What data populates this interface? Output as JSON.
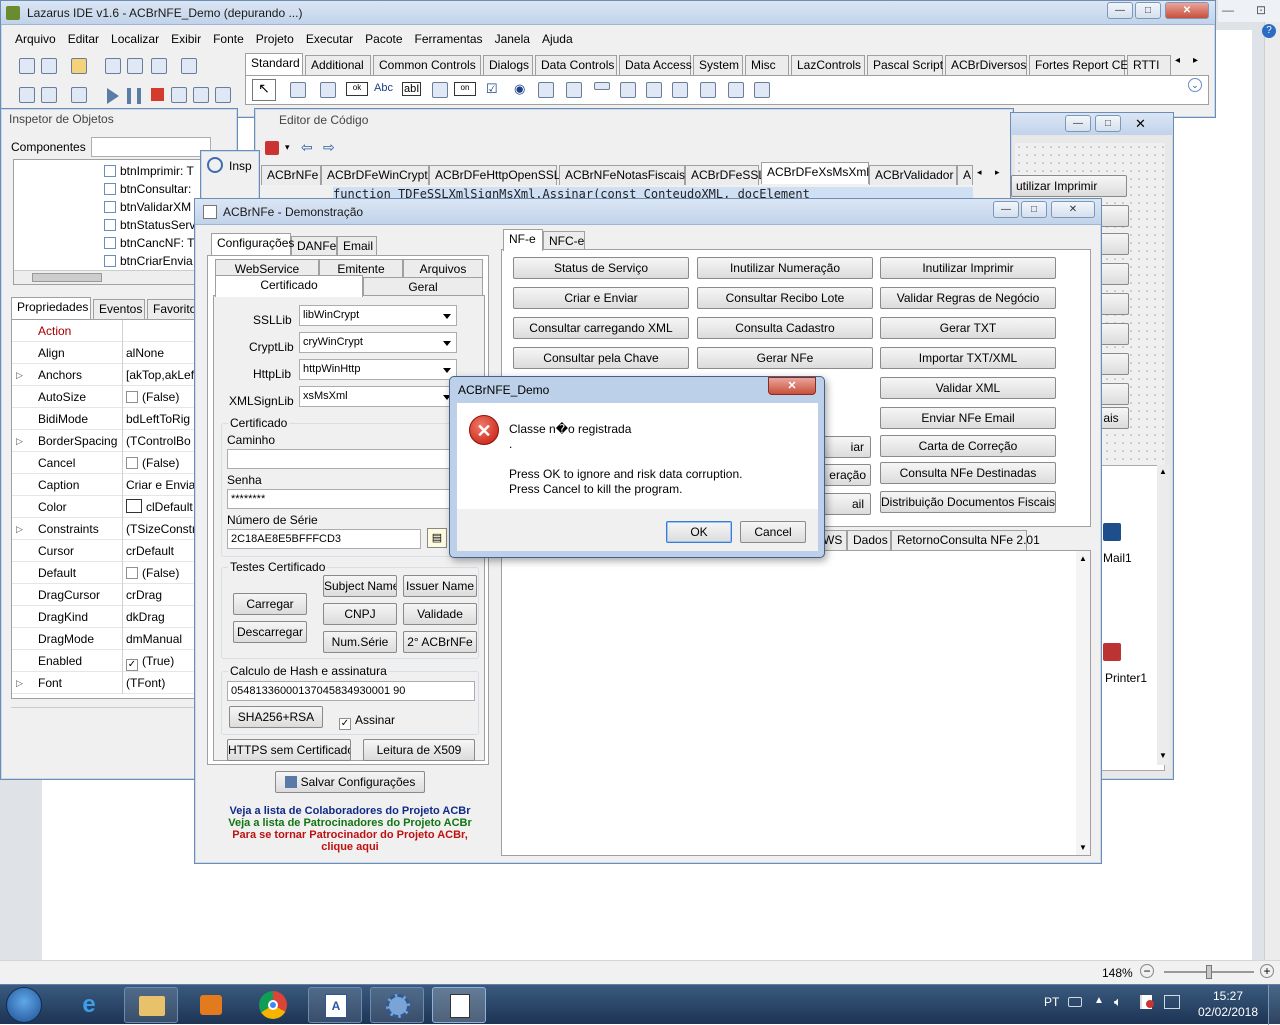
{
  "ide": {
    "title": "Lazarus IDE v1.6 - ACBrNFE_Demo (depurando ...)",
    "menu": [
      "Arquivo",
      "Editar",
      "Localizar",
      "Exibir",
      "Fonte",
      "Projeto",
      "Executar",
      "Pacote",
      "Ferramentas",
      "Janela",
      "Ajuda"
    ],
    "palette_tabs": [
      "Standard",
      "Additional",
      "Common Controls",
      "Dialogs",
      "Data Controls",
      "Data Access",
      "System",
      "Misc",
      "LazControls",
      "Pascal Script",
      "ACBrDiversos",
      "Fortes Report CE",
      "RTTI"
    ]
  },
  "inspector": {
    "title": "Inspetor de Objetos",
    "components_label": "Componentes",
    "tree": [
      "btnImprimir: T",
      "btnConsultar:",
      "btnValidarXM",
      "btnStatusServ",
      "btnCancNF: T",
      "btnCriarEnvia"
    ],
    "tabs": [
      "Propriedades",
      "Eventos",
      "Favorito"
    ],
    "props": [
      {
        "name": "Action",
        "value": ""
      },
      {
        "name": "Align",
        "value": "alNone"
      },
      {
        "name": "Anchors",
        "value": "[akTop,akLeft"
      },
      {
        "name": "AutoSize",
        "value": "(False)"
      },
      {
        "name": "BidiMode",
        "value": "bdLeftToRig"
      },
      {
        "name": "BorderSpacing",
        "value": "(TControlBo"
      },
      {
        "name": "Cancel",
        "value": "(False)"
      },
      {
        "name": "Caption",
        "value": "Criar e Envia"
      },
      {
        "name": "Color",
        "value": "clDefault"
      },
      {
        "name": "Constraints",
        "value": "(TSizeConstr"
      },
      {
        "name": "Cursor",
        "value": "crDefault"
      },
      {
        "name": "Default",
        "value": "(False)"
      },
      {
        "name": "DragCursor",
        "value": "crDrag"
      },
      {
        "name": "DragKind",
        "value": "dkDrag"
      },
      {
        "name": "DragMode",
        "value": "dmManual"
      },
      {
        "name": "Enabled",
        "value": "(True)"
      },
      {
        "name": "Font",
        "value": "(TFont)"
      }
    ]
  },
  "editor": {
    "title": "Editor de Código",
    "tabs": [
      "ACBrNFe",
      "ACBrDFeWinCrypt",
      "ACBrDFeHttpOpenSSL",
      "ACBrNFeNotasFiscais",
      "ACBrDFeSSL",
      "ACBrDFeXsMsXml",
      "ACBrValidador",
      "A"
    ],
    "code_line": "function TDFeSSLXmlSignMsXml.Assinar(const ConteudoXML, docElement"
  },
  "inspector2_title": "Insp",
  "form_designer": {
    "btn_inutilizar_imprimir": "utilizar Imprimir",
    "mail1": "Mail1",
    "printer1": "Printer1"
  },
  "demo": {
    "title": "ACBrNFe - Demonstração",
    "left_tabs": [
      "Configurações",
      "DANFe",
      "Email"
    ],
    "sub_tabs_row1": [
      "WebService",
      "Emitente",
      "Arquivos"
    ],
    "sub_tabs_row2": [
      "Certificado",
      "Geral"
    ],
    "ssllib_label": "SSLLib",
    "ssllib": "libWinCrypt",
    "cryptlib_label": "CryptLib",
    "cryptlib": "cryWinCrypt",
    "httplib_label": "HttpLib",
    "httplib": "httpWinHttp",
    "xmlsign_label": "XMLSignLib",
    "xmlsign": "xsMsXml",
    "cert_group": "Certificado",
    "caminho_label": "Caminho",
    "senha_label": "Senha",
    "senha_value": "********",
    "serie_label": "Número de Série",
    "serie_value": "2C18AE8E5BFFFCD3",
    "testes_group": "Testes Certificado",
    "btn_carregar": "Carregar",
    "btn_descarregar": "Descarregar",
    "btn_subject": "Subject Name",
    "btn_issuer": "Issuer Name",
    "btn_cnpj": "CNPJ",
    "btn_validade": "Validade",
    "btn_numserie": "Num.Série",
    "btn_2acbr": "2° ACBrNFe",
    "hash_group": "Calculo de Hash e assinatura",
    "hash_value": "05481336000137045834930001 90",
    "btn_sha": "SHA256+RSA",
    "assinar_label": "Assinar",
    "btn_https": "HTTPS sem Certificado",
    "btn_x509": "Leitura de X509",
    "btn_salvar": "Salvar Configurações",
    "link_colab": "Veja a lista de Colaboradores do Projeto ACBr",
    "link_patro": "Veja a lista de Patrocinadores do Projeto ACBr",
    "link_tornar1": "Para se tornar Patrocinador do Projeto ACBr,",
    "link_tornar2": "clique aqui",
    "right_tabs": [
      "NF-e",
      "NFC-e"
    ],
    "actions": [
      [
        "Status de Serviço",
        "Inutilizar Numeração",
        "Inutilizar Imprimir"
      ],
      [
        "Criar e Enviar",
        "Consultar Recibo Lote",
        "Validar Regras de Negócio"
      ],
      [
        "Consultar carregando XML",
        "Consulta Cadastro",
        "Gerar TXT"
      ],
      [
        "Consultar pela Chave",
        "Gerar NFe",
        "Importar TXT/XML"
      ],
      [
        "",
        "",
        "Validar XML"
      ],
      [
        "",
        "",
        "Enviar NFe Email"
      ],
      [
        "",
        "",
        "Carta de Correção"
      ],
      [
        "",
        "",
        "Consulta NFe Destinadas"
      ],
      [
        "",
        "",
        "Distribuição Documentos Fiscais"
      ]
    ],
    "partial_btn_right": "ais",
    "partial_a": "iar",
    "partial_b": "eração",
    "partial_c": "ail",
    "resp_tabs": [
      "WS",
      "Dados",
      "RetornoConsulta NFe 2.01"
    ]
  },
  "dialog": {
    "title": "ACBrNFE_Demo",
    "line1": "Classe n�o registrada",
    "line2": ".",
    "line3": "Press OK to ignore and risk data corruption.",
    "line4": "Press Cancel to kill the program.",
    "ok": "OK",
    "cancel": "Cancel"
  },
  "statusbar": {
    "zoom": "148%"
  },
  "taskbar": {
    "lang": "PT",
    "time": "15:27",
    "date": "02/02/2018"
  }
}
